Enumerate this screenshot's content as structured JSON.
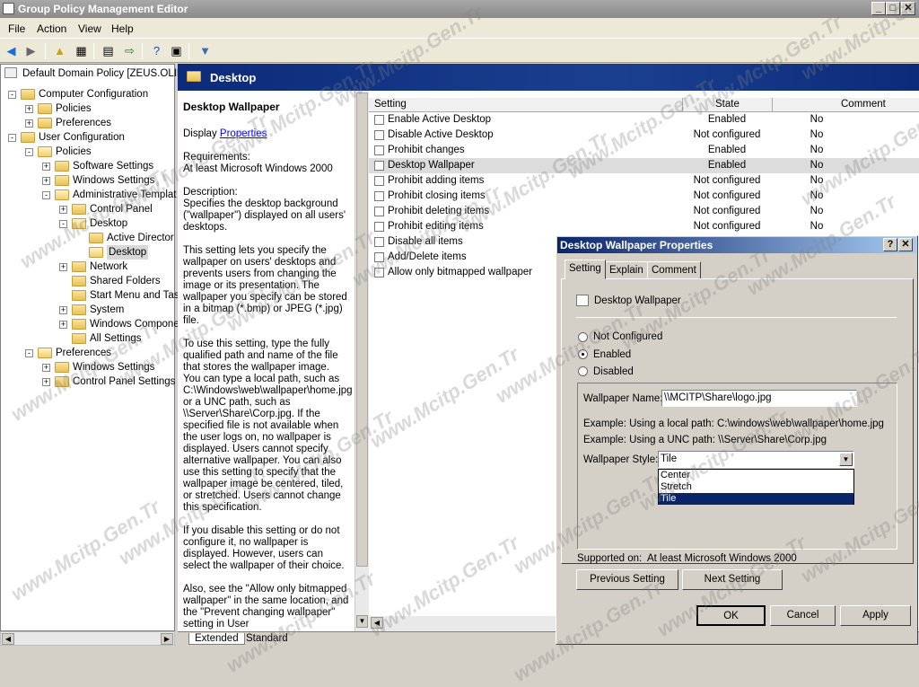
{
  "window": {
    "title": "Group Policy Management Editor"
  },
  "menu": [
    "File",
    "Action",
    "View",
    "Help"
  ],
  "tree": {
    "root": "Default Domain Policy [ZEUS.OLIMP",
    "items": [
      "Computer Configuration",
      "Policies",
      "Preferences",
      "User Configuration",
      "Policies",
      "Software Settings",
      "Windows Settings",
      "Administrative Templat",
      "Control Panel",
      "Desktop",
      "Active Director",
      "Desktop",
      "Network",
      "Shared Folders",
      "Start Menu and Tas",
      "System",
      "Windows Compone",
      "All Settings",
      "Preferences",
      "Windows Settings",
      "Control Panel Settings"
    ]
  },
  "detail_header": "Desktop",
  "description": {
    "title": "Desktop Wallpaper",
    "display_prefix": "Display",
    "display_link": "Properties",
    "requirements_label": "Requirements:",
    "requirements": "At least Microsoft Windows 2000",
    "description_label": "Description:",
    "p1": "Specifies the desktop background (\"wallpaper\") displayed on all users' desktops.",
    "p2": "This setting lets you specify the wallpaper on users' desktops and prevents users from changing the image or its presentation. The wallpaper you specify can be stored in a bitmap (*.bmp) or JPEG (*.jpg) file.",
    "p3": "To use this setting, type the fully qualified path and name of the file that stores the wallpaper image. You can type a local path, such as C:\\Windows\\web\\wallpaper\\home.jpg or a UNC path, such as \\\\Server\\Share\\Corp.jpg. If the specified file is not available when the user logs on, no wallpaper is displayed. Users cannot specify alternative wallpaper. You can also use this setting to specify that the wallpaper image be centered, tiled, or stretched. Users cannot change this specification.",
    "p4": "If you disable this setting or do not configure it, no wallpaper is displayed. However, users can select the wallpaper of their choice.",
    "p5": "Also, see the \"Allow only bitmapped wallpaper\" in the same location, and the \"Prevent changing wallpaper\" setting in User"
  },
  "list": {
    "columns": [
      "Setting",
      "State",
      "Comment"
    ],
    "rows": [
      {
        "name": "Enable Active Desktop",
        "state": "Enabled",
        "comment": "No"
      },
      {
        "name": "Disable Active Desktop",
        "state": "Not configured",
        "comment": "No"
      },
      {
        "name": "Prohibit changes",
        "state": "Enabled",
        "comment": "No"
      },
      {
        "name": "Desktop Wallpaper",
        "state": "Enabled",
        "comment": "No"
      },
      {
        "name": "Prohibit adding items",
        "state": "Not configured",
        "comment": "No"
      },
      {
        "name": "Prohibit closing items",
        "state": "Not configured",
        "comment": "No"
      },
      {
        "name": "Prohibit deleting items",
        "state": "Not configured",
        "comment": "No"
      },
      {
        "name": "Prohibit editing items",
        "state": "Not configured",
        "comment": "No"
      },
      {
        "name": "Disable all items",
        "state": "",
        "comment": ""
      },
      {
        "name": "Add/Delete items",
        "state": "",
        "comment": ""
      },
      {
        "name": "Allow only bitmapped wallpaper",
        "state": "",
        "comment": ""
      }
    ]
  },
  "bottom_tabs": [
    "Extended",
    "Standard"
  ],
  "dialog": {
    "title": "Desktop Wallpaper Properties",
    "help": "?",
    "close": "✕",
    "tabs": [
      "Setting",
      "Explain",
      "Comment"
    ],
    "policy_name": "Desktop Wallpaper",
    "radios": [
      "Not Configured",
      "Enabled",
      "Disabled"
    ],
    "selected": "Enabled",
    "wallpaper_name_label": "Wallpaper Name:",
    "wallpaper_name_value": "\\\\MCITP\\Share\\logo.jpg",
    "example_local": "Example: Using a local path:   C:\\windows\\web\\wallpaper\\home.jpg",
    "example_unc": "Example: Using a UNC path:     \\\\Server\\Share\\Corp.jpg",
    "style_label": "Wallpaper Style:",
    "style_value": "Tile",
    "style_options": [
      "Center",
      "Stretch",
      "Tile"
    ],
    "supported_label": "Supported on:",
    "supported_value": "At least Microsoft Windows 2000",
    "prev_button": "Previous Setting",
    "next_button": "Next Setting",
    "ok": "OK",
    "cancel": "Cancel",
    "apply": "Apply"
  },
  "watermark": "www.Mcitp.Gen.Tr"
}
